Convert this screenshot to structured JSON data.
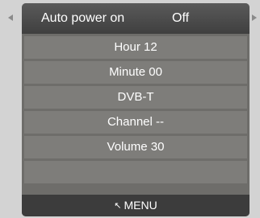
{
  "nav": {
    "left_icon": "left-arrow-icon",
    "right_icon": "right-arrow-icon"
  },
  "selected": {
    "label": "Auto power on",
    "value": "Off"
  },
  "items": [
    {
      "label": "Hour 12"
    },
    {
      "label": "Minute 00"
    },
    {
      "label": "DVB-T"
    },
    {
      "label": "Channel --"
    },
    {
      "label": "Volume 30"
    },
    {
      "label": ""
    }
  ],
  "footer": {
    "icon": "return-icon",
    "icon_glyph": "↖",
    "label": "MENU"
  },
  "colors": {
    "background": "#d3d3d3",
    "panel": "#6e6d6a",
    "row": "#7e7d7a",
    "selected_row": "#4a4a4a",
    "footer": "#3c3c3c",
    "text": "#ffffff"
  }
}
